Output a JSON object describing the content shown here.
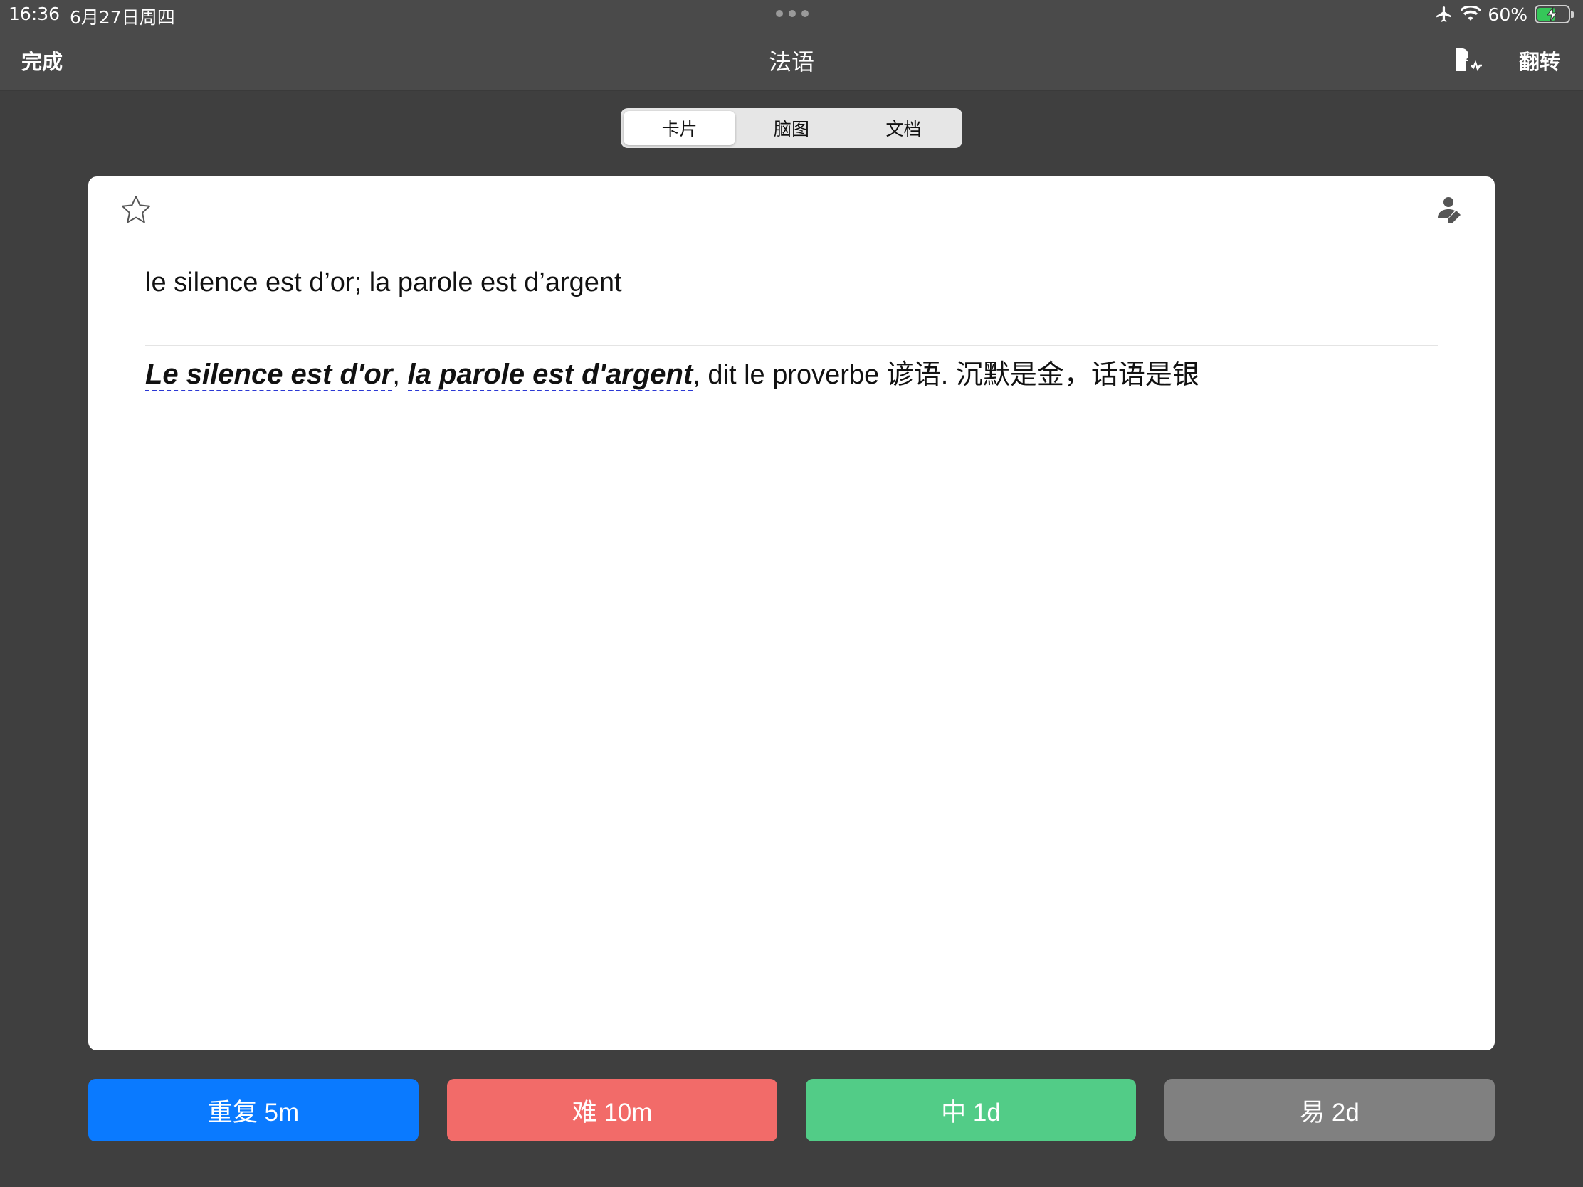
{
  "status": {
    "time": "16:36",
    "date": "6月27日周四",
    "battery_text": "60%",
    "battery_level": 0.6,
    "icons": [
      "airplane-icon",
      "wifi-icon",
      "battery-icon"
    ]
  },
  "nav": {
    "done_label": "完成",
    "title": "法语",
    "flip_label": "翻转",
    "tts_icon": "speak-icon"
  },
  "segments": [
    {
      "label": "卡片",
      "active": true
    },
    {
      "label": "脑图",
      "active": false
    },
    {
      "label": "文档",
      "active": false
    }
  ],
  "card": {
    "question": "le silence est d’or; la parole est d’argent",
    "answer": {
      "em1": "Le silence est d'or",
      "sep": ", ",
      "em2": "la parole est d'argent",
      "rest": ", dit le proverbe 谚语. 沉默是金，话语是银"
    }
  },
  "buttons": [
    {
      "label": "重复 5m",
      "color": "#0a7aff"
    },
    {
      "label": "难 10m",
      "color": "#f26b69"
    },
    {
      "label": "中 1d",
      "color": "#52cc87"
    },
    {
      "label": "易 2d",
      "color": "#808080"
    }
  ]
}
